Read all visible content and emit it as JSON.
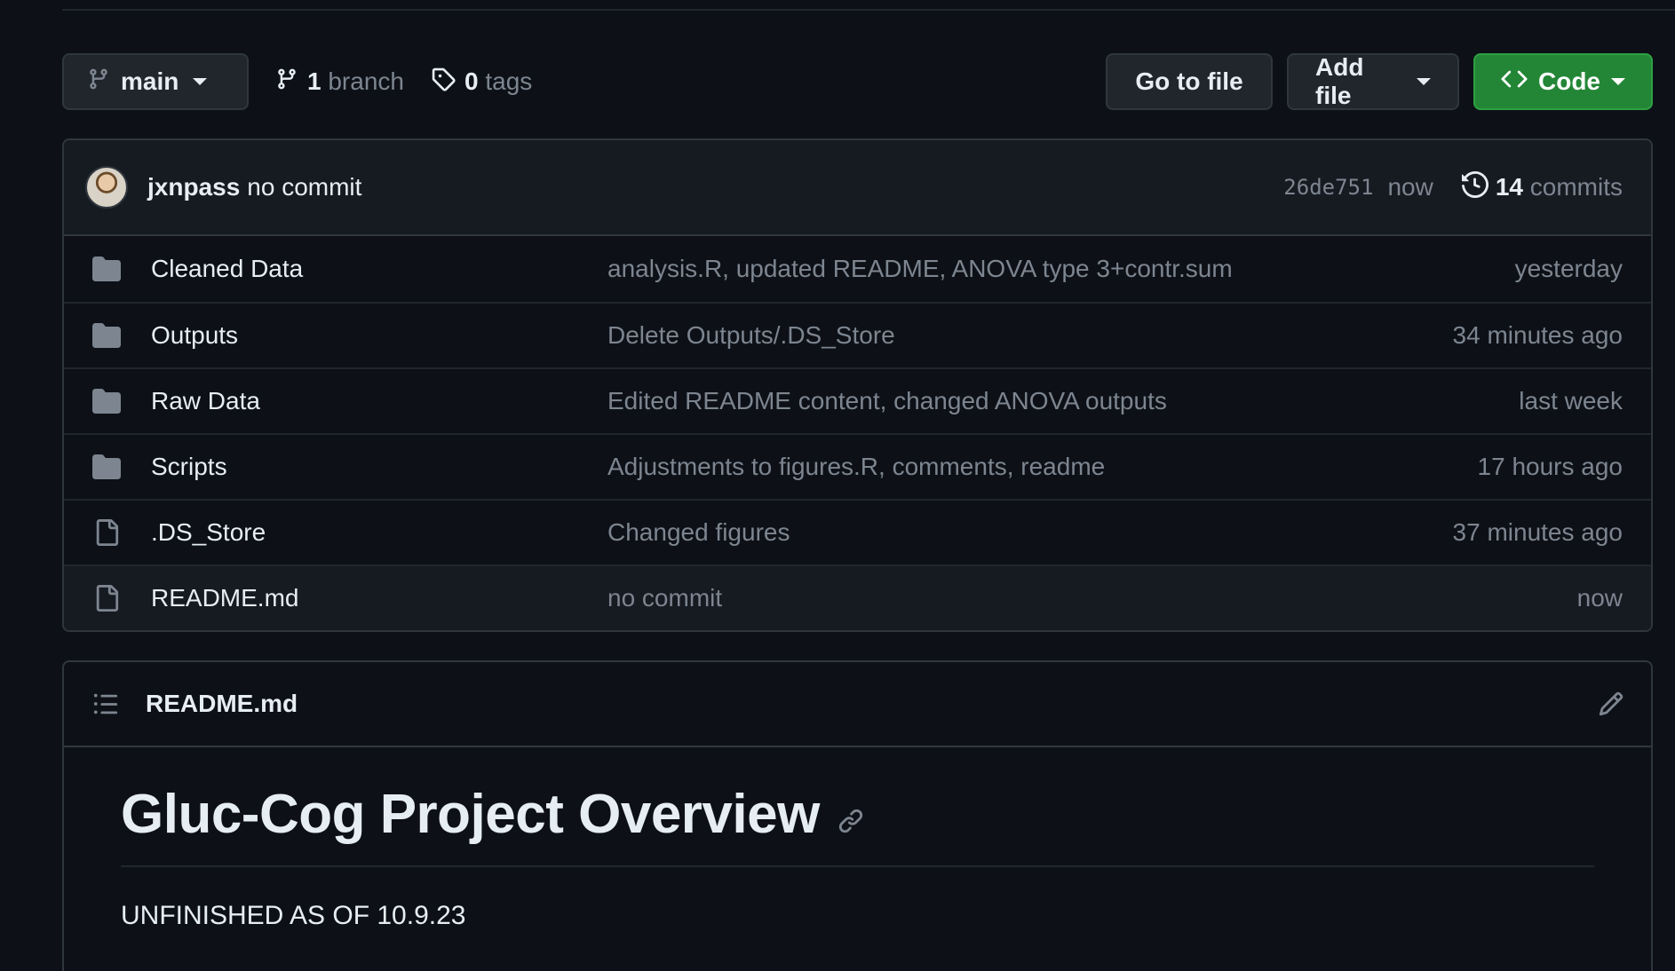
{
  "toolbar": {
    "branch_name": "main",
    "branch_count": "1",
    "branch_label": "branch",
    "tag_count": "0",
    "tag_label": "tags",
    "goto_label": "Go to file",
    "add_file_label": "Add file",
    "code_label": "Code"
  },
  "latest_commit": {
    "author": "jxnpass",
    "message": "no commit",
    "sha": "26de751",
    "time": "now",
    "commit_count": "14",
    "commit_label": "commits"
  },
  "files": [
    {
      "type": "folder",
      "name": "Cleaned Data",
      "message": "analysis.R, updated README, ANOVA type 3+contr.sum",
      "age": "yesterday"
    },
    {
      "type": "folder",
      "name": "Outputs",
      "message": "Delete Outputs/.DS_Store",
      "age": "34 minutes ago"
    },
    {
      "type": "folder",
      "name": "Raw Data",
      "message": "Edited README content, changed ANOVA outputs",
      "age": "last week"
    },
    {
      "type": "folder",
      "name": "Scripts",
      "message": "Adjustments to figures.R, comments, readme",
      "age": "17 hours ago"
    },
    {
      "type": "file",
      "name": ".DS_Store",
      "message": "Changed figures",
      "age": "37 minutes ago"
    },
    {
      "type": "file",
      "name": "README.md",
      "message": "no commit",
      "age": "now"
    }
  ],
  "readme": {
    "filename": "README.md",
    "heading": "Gluc-Cog Project Overview",
    "paragraph": "UNFINISHED AS OF 10.9.23"
  },
  "colors": {
    "background": "#0d1117",
    "code_button": "#238636",
    "muted_text": "#7d8590",
    "border": "#30363d"
  },
  "icons": [
    "git-branch-icon",
    "tag-icon",
    "code-icon",
    "history-icon",
    "folder-icon",
    "file-icon",
    "list-icon",
    "pencil-icon",
    "link-icon"
  ]
}
